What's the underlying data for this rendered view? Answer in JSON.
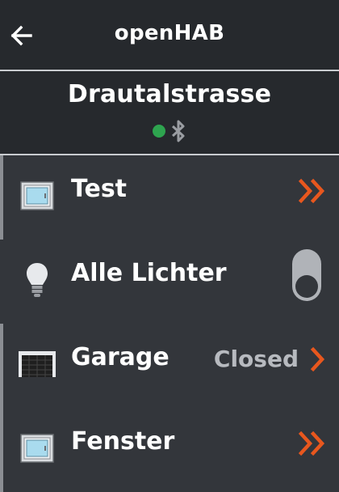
{
  "appbar": {
    "title": "openHAB",
    "back_icon": "arrow-left-icon"
  },
  "header": {
    "location": "Drautalstrasse",
    "status_dot_color": "#2ea44f",
    "bluetooth_icon": "bluetooth-icon"
  },
  "items": [
    {
      "label": "Test",
      "icon": "window-icon",
      "action": "double-chevron-right-icon",
      "accent": true
    },
    {
      "label": "Alle Lichter",
      "icon": "lightbulb-icon",
      "control": "switch",
      "switch_on": false,
      "accent": false
    },
    {
      "label": "Garage",
      "icon": "garage-door-icon",
      "state": "Closed",
      "action": "chevron-right-icon",
      "accent": true
    },
    {
      "label": "Fenster",
      "icon": "window-icon",
      "action": "double-chevron-right-icon",
      "accent": true
    }
  ],
  "colors": {
    "background": "#33363b",
    "bar": "#26292d",
    "accent_orange": "#e8571e",
    "status_online": "#2ea44f"
  }
}
